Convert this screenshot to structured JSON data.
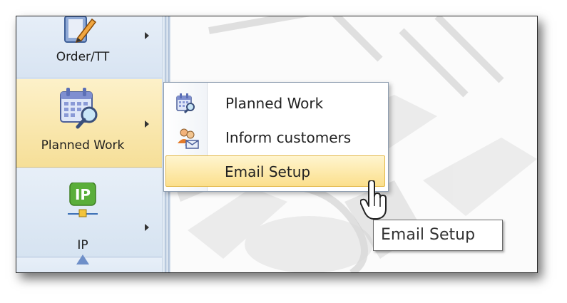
{
  "sidebar": {
    "items": [
      {
        "label": "Order/TT",
        "icon": "pencil-notepad-icon"
      },
      {
        "label": "Planned Work",
        "icon": "calendar-magnifier-icon",
        "active": true
      },
      {
        "label": "IP",
        "icon": "ip-network-icon"
      },
      {
        "label": "",
        "icon": "partial-icon"
      }
    ]
  },
  "menu": {
    "items": [
      {
        "label": "Planned Work",
        "icon": "calendar-magnifier-icon"
      },
      {
        "label": "Inform customers",
        "icon": "users-mail-icon"
      },
      {
        "label": "Email Setup",
        "icon": "",
        "hovered": true
      }
    ]
  },
  "tooltip": {
    "text": "Email Setup"
  },
  "colors": {
    "highlight": "#fbdf8c",
    "sidebar": "#dbe6f3",
    "ip_green": "#5aae3a"
  }
}
